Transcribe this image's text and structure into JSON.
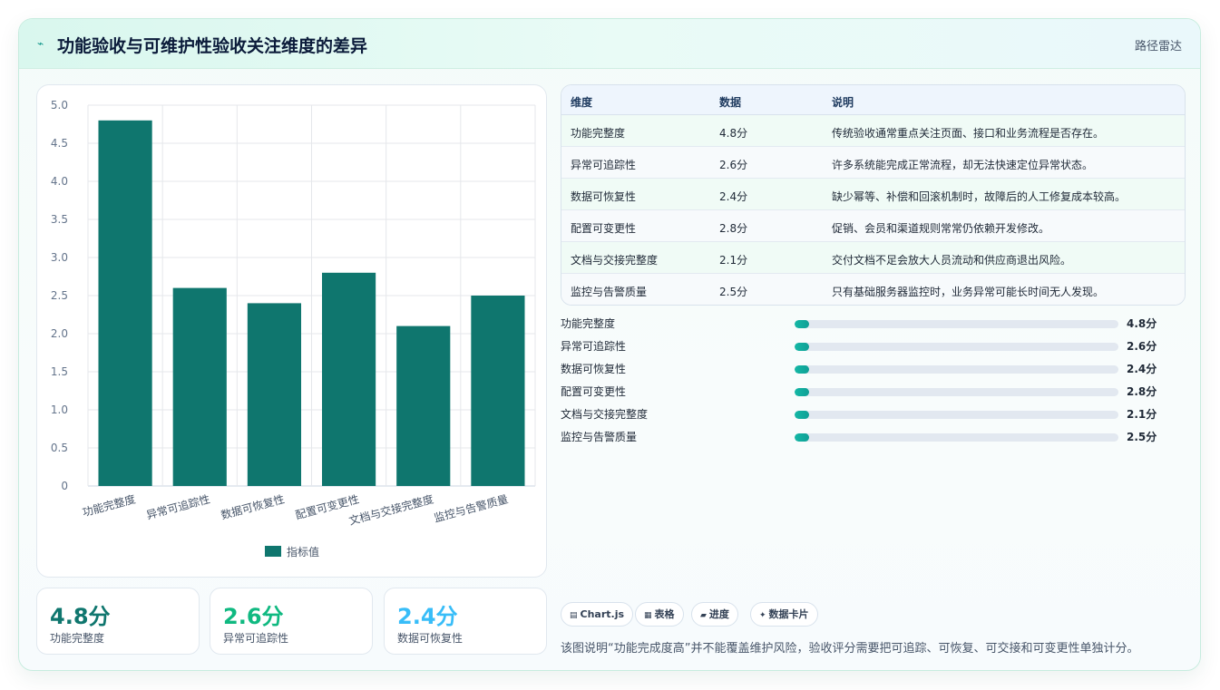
{
  "header": {
    "icon": "lightning-icon",
    "icon_glyph": "⌁",
    "title": "功能验收与可维护性验收关注维度的差异",
    "tag": "路径雷达"
  },
  "chart_data": {
    "type": "bar",
    "categories": [
      "功能完整度",
      "异常可追踪性",
      "数据可恢复性",
      "配置可变更性",
      "文档与交接完整度",
      "监控与告警质量"
    ],
    "series": [
      {
        "name": "指标值",
        "values": [
          4.8,
          2.6,
          2.4,
          2.8,
          2.1,
          2.5
        ],
        "color": "#0f766e"
      }
    ],
    "ylim": [
      0,
      5.0
    ],
    "yticks": [
      "0",
      "0.5",
      "1.0",
      "1.5",
      "2.0",
      "2.5",
      "3.0",
      "3.5",
      "4.0",
      "4.5",
      "5.0"
    ],
    "grid": true,
    "legend": "bottom"
  },
  "kpis": [
    {
      "value": "4.8分",
      "label": "功能完整度",
      "color": "#0f766e"
    },
    {
      "value": "2.6分",
      "label": "异常可追踪性",
      "color": "#10b981"
    },
    {
      "value": "2.4分",
      "label": "数据可恢复性",
      "color": "#38bdf8"
    }
  ],
  "table": {
    "headers": [
      "维度",
      "数据",
      "说明"
    ],
    "rows": [
      [
        "功能完整度",
        "4.8分",
        "传统验收通常重点关注页面、接口和业务流程是否存在。"
      ],
      [
        "异常可追踪性",
        "2.6分",
        "许多系统能完成正常流程，却无法快速定位异常状态。"
      ],
      [
        "数据可恢复性",
        "2.4分",
        "缺少幂等、补偿和回滚机制时，故障后的人工修复成本较高。"
      ],
      [
        "配置可变更性",
        "2.8分",
        "促销、会员和渠道规则常常仍依赖开发修改。"
      ],
      [
        "文档与交接完整度",
        "2.1分",
        "交付文档不足会放大人员流动和供应商退出风险。"
      ],
      [
        "监控与告警质量",
        "2.5分",
        "只有基础服务器监控时，业务异常可能长时间无人发现。"
      ]
    ]
  },
  "progress": [
    {
      "label": "功能完整度",
      "value": "4.8分",
      "fraction": 0.045
    },
    {
      "label": "异常可追踪性",
      "value": "2.6分",
      "fraction": 0.045
    },
    {
      "label": "数据可恢复性",
      "value": "2.4分",
      "fraction": 0.045
    },
    {
      "label": "配置可变更性",
      "value": "2.8分",
      "fraction": 0.045
    },
    {
      "label": "文档与交接完整度",
      "value": "2.1分",
      "fraction": 0.045
    },
    {
      "label": "监控与告警质量",
      "value": "2.5分",
      "fraction": 0.045
    }
  ],
  "chips": [
    {
      "icon": "chart-icon",
      "glyph": "▤",
      "label": "Chart.js"
    },
    {
      "icon": "table-icon",
      "glyph": "▦",
      "label": "表格"
    },
    {
      "icon": "progress-icon",
      "glyph": "▰",
      "label": "进度"
    },
    {
      "icon": "sparkle-icon",
      "glyph": "✦",
      "label": "数据卡片"
    }
  ],
  "note": "该图说明“功能完成度高”并不能覆盖维护风险，验收评分需要把可追踪、可恢复、可交接和可变更性单独计分。"
}
